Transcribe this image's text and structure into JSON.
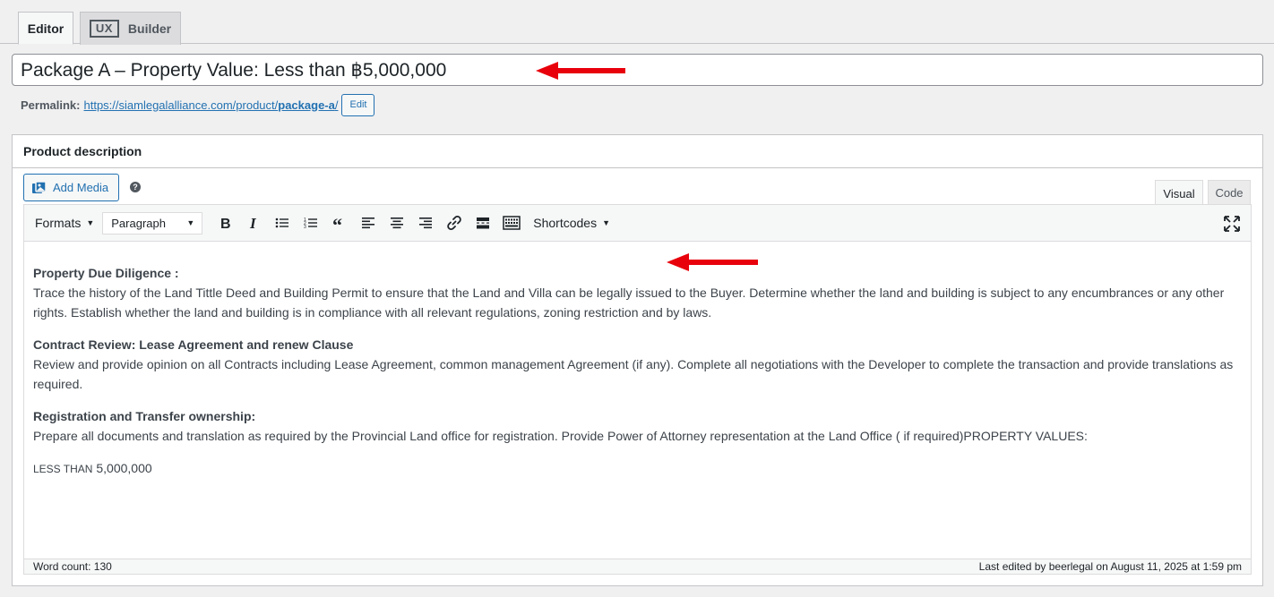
{
  "top_tabs": {
    "editor_label": "Editor",
    "ux_badge": "UX",
    "builder_label": "Builder"
  },
  "title": {
    "value": "Package A – Property Value: Less than ฿5,000,000"
  },
  "permalink": {
    "label": "Permalink:",
    "url_prefix": "https://siamlegalalliance.com/product/",
    "url_slug": "package-a",
    "url_suffix": "/",
    "edit_label": "Edit"
  },
  "postbox": {
    "title": "Product description",
    "add_media_label": "Add Media",
    "help_glyph": "?",
    "visual_tab": "Visual",
    "code_tab": "Code"
  },
  "toolbar": {
    "formats_label": "Formats",
    "paragraph_label": "Paragraph",
    "shortcodes_label": "Shortcodes",
    "icons": [
      "bold-icon",
      "italic-icon",
      "bullet-list-icon",
      "numbered-list-icon",
      "blockquote-icon",
      "align-left-icon",
      "align-center-icon",
      "align-right-icon",
      "link-icon",
      "read-more-icon",
      "toolbar-toggle-icon"
    ]
  },
  "content": {
    "s1_heading": "Property Due Diligence :",
    "s1_text": "Trace the history of the Land Tittle Deed and Building Permit to ensure that the Land and Villa can be legally issued to the Buyer. Determine whether the land and building is subject to any encumbrances or any other rights. Establish whether the land and building is in compliance with all relevant regulations, zoning restriction and by laws.",
    "s2_heading": "Contract Review: Lease Agreement and renew Clause",
    "s2_text": "Review and provide opinion on all Contracts including Lease Agreement, common management Agreement (if any). Complete all negotiations with the Developer to complete the transaction and provide translations as required.",
    "s3_heading": "Registration and Transfer ownership:",
    "s3_text": "Prepare all documents and translation as required by the Provincial Land office for registration. Provide Power of Attorney representation at the Land Office ( if required)PROPERTY VALUES:",
    "less_than_label": "LESS THAN",
    "less_than_value": "5,000,000"
  },
  "status": {
    "word_count": "Word count: 130",
    "last_edited": "Last edited by beerlegal on August 11, 2025 at 1:59 pm"
  },
  "colors": {
    "accent": "#2271b1",
    "arrow": "#e8000b",
    "background": "#f0f0f1"
  }
}
